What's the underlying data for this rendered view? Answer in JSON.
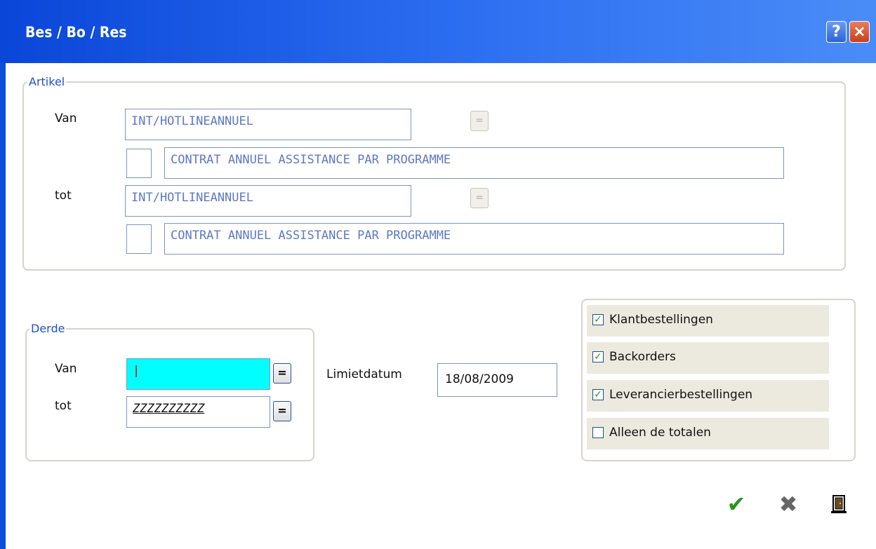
{
  "window": {
    "title": "Bes / Bo / Res",
    "help_label": "?",
    "close_label": "×"
  },
  "artikel": {
    "legend": "Artikel",
    "van_label": "Van",
    "tot_label": "tot",
    "van_code": "INT/HOTLINEANNUEL",
    "van_desc": "CONTRAT ANNUEL ASSISTANCE PAR PROGRAMME",
    "tot_code": "INT/HOTLINEANNUEL",
    "tot_desc": "CONTRAT ANNUEL ASSISTANCE PAR PROGRAMME",
    "lookup_label": "="
  },
  "derde": {
    "legend": "Derde",
    "van_label": "Van",
    "tot_label": "tot",
    "van_value": "|",
    "tot_value": "ZZZZZZZZZZ",
    "lookup_label": "="
  },
  "limit": {
    "label": "Limietdatum",
    "value": "18/08/2009"
  },
  "options": [
    {
      "label": "Klantbestellingen",
      "checked": true
    },
    {
      "label": "Backorders",
      "checked": true
    },
    {
      "label": "Leverancierbestellingen",
      "checked": true
    },
    {
      "label": "Alleen de totalen",
      "checked": false
    }
  ],
  "actions": {
    "ok_icon": "checkmark-icon",
    "cancel_icon": "cancel-icon",
    "exit_icon": "door-icon",
    "accent_green": "#2f8f1f",
    "cancel_gray": "#666666"
  }
}
